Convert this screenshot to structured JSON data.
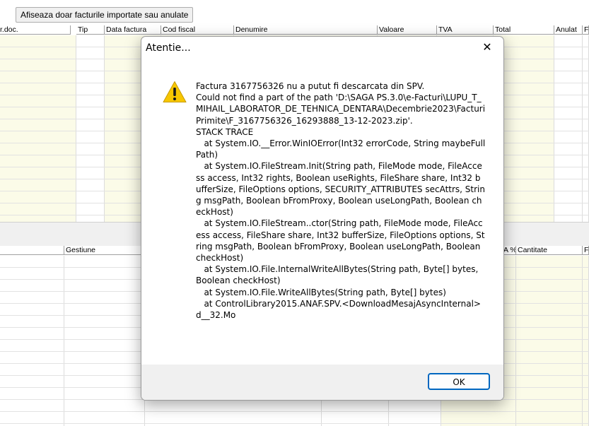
{
  "app": {
    "filter_button": "Afiseaza doar facturile importate sau anulate",
    "top_grid": {
      "columns": [
        "r.doc.",
        "Tip",
        "Data factura",
        "Cod fiscal",
        "Denumire",
        "Valoare",
        "TVA",
        "Total",
        "Anulat",
        "F"
      ]
    },
    "bottom_grid": {
      "columns": [
        "Gestiune",
        "A %",
        "Cantitate",
        "F"
      ]
    }
  },
  "dialog": {
    "title": "Atentie...",
    "close_glyph": "✕",
    "icon": "warning-icon",
    "message": "Factura 3167756326 nu a putut fi descarcata din SPV.\nCould not find a part of the path 'D:\\SAGA PS.3.0\\e-Facturi\\LUPU_T_MIHAIL_LABORATOR_DE_TEHNICA_DENTARA\\Decembrie2023\\FacturiPrimite\\F_3167756326_16293888_13-12-2023.zip'.\nSTACK TRACE\n   at System.IO.__Error.WinIOError(Int32 errorCode, String maybeFullPath)\n   at System.IO.FileStream.Init(String path, FileMode mode, FileAccess access, Int32 rights, Boolean useRights, FileShare share, Int32 bufferSize, FileOptions options, SECURITY_ATTRIBUTES secAttrs, String msgPath, Boolean bFromProxy, Boolean useLongPath, Boolean checkHost)\n   at System.IO.FileStream..ctor(String path, FileMode mode, FileAccess access, FileShare share, Int32 bufferSize, FileOptions options, String msgPath, Boolean bFromProxy, Boolean useLongPath, Boolean checkHost)\n   at System.IO.File.InternalWriteAllBytes(String path, Byte[] bytes, Boolean checkHost)\n   at System.IO.File.WriteAllBytes(String path, Byte[] bytes)\n   at ControlLibrary2015.ANAF.SPV.<DownloadMesajAsyncInternal>d__32.Mo",
    "ok_label": "OK"
  },
  "colors": {
    "accent": "#0067c0",
    "warning_yellow": "#f7c600",
    "grid_yellow": "#fbfbe8"
  }
}
